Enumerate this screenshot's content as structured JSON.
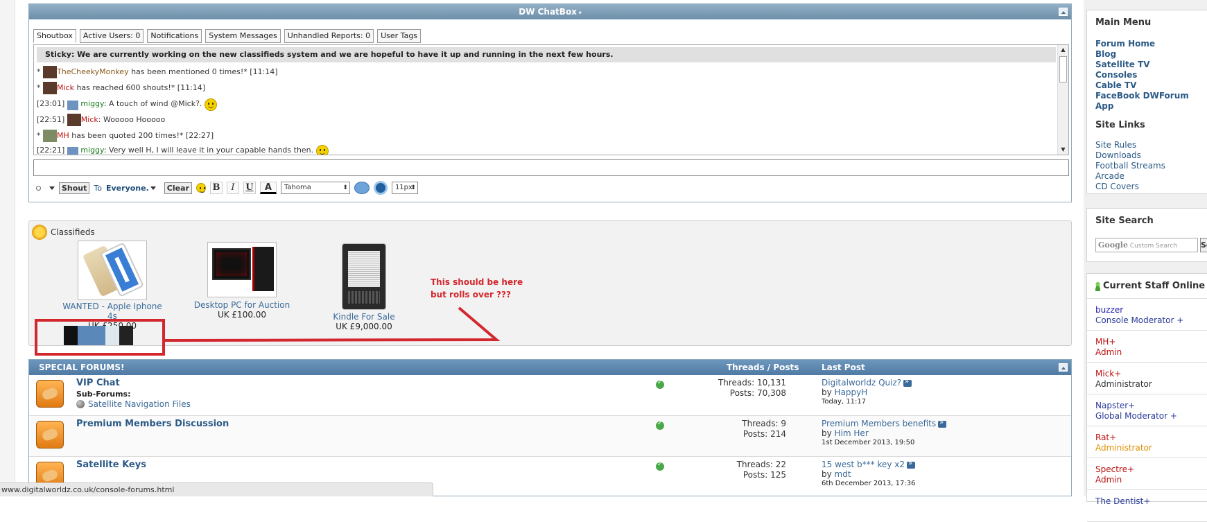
{
  "chatbox": {
    "title": "DW ChatBox",
    "tabs": [
      "Shoutbox",
      "Active Users: 0",
      "Notifications",
      "System Messages",
      "Unhandled Reports: 0",
      "User Tags"
    ],
    "sticky": "Sticky: We are currently working on the new classifieds system and we are hopeful to have it up and running in the next few hours.",
    "messages": [
      {
        "pre": "*",
        "user": "TheCheekyMonkey",
        "text": " has been mentioned 0 times!* [11:14]"
      },
      {
        "pre": "*",
        "user": "Mick",
        "text": " has reached 600 shouts!* [11:14]"
      },
      {
        "pre": "[23:01]",
        "user": "miggy",
        "text": ": A touch of wind @Mick?."
      },
      {
        "pre": "[22:51]",
        "user": "Mick",
        "text": ": Wooooo Hooooo"
      },
      {
        "pre": "*",
        "user": "MH",
        "text": " has been quoted 200 times!* [22:27]"
      },
      {
        "pre": "[22:21]",
        "user": "miggy",
        "text": ": Very well H, I will leave it in your capable hands then."
      }
    ],
    "toolbar": {
      "shout": "Shout",
      "to": "To",
      "everyone": "Everyone.",
      "clear": "Clear",
      "bold": "B",
      "italic": "I",
      "underline": "U",
      "fontcolor": "A",
      "font": "Tahoma",
      "size": "11px"
    }
  },
  "classifieds": {
    "title": "Classifieds",
    "items": [
      {
        "name": "WANTED - Apple Iphone 4s",
        "price": "UK £250.00"
      },
      {
        "name": "Desktop PC for Auction",
        "price": "UK £100.00"
      },
      {
        "name": "Kindle For Sale",
        "price": "UK £9,000.00"
      }
    ],
    "note_line1": "This should be here",
    "note_line2": "but rolls over ???"
  },
  "forums": {
    "title": "SPECIAL FORUMS!",
    "col_threads": "Threads / Posts",
    "col_last": "Last Post",
    "rows": [
      {
        "title": "VIP Chat",
        "sub_label": "Sub-Forums:",
        "sub_link": "Satellite Navigation Files",
        "threads": "Threads: 10,131",
        "posts": "Posts: 70,308",
        "last_title": "Digitalworldz Quiz?",
        "by": "by",
        "last_user": "HappyH",
        "last_date": "Today, 11:17"
      },
      {
        "title": "Premium Members Discussion",
        "threads": "Threads: 9",
        "posts": "Posts: 214",
        "last_title": "Premium Members benefits",
        "by": "by",
        "last_user": "Him Her",
        "last_date": "1st December 2013, 19:50"
      },
      {
        "title": "Satellite Keys",
        "threads": "Threads: 22",
        "posts": "Posts: 125",
        "last_title": "15 west b*** key x2",
        "by": "by",
        "last_user": "mdt",
        "last_date": "6th December 2013, 17:36"
      }
    ]
  },
  "statusbar": {
    "url": "www.digitalworldz.co.uk/console-forums.html"
  },
  "sidebar": {
    "main_menu": {
      "title": "Main Menu",
      "links": [
        "Forum Home",
        "Blog",
        "Satellite TV",
        "Consoles",
        "Cable TV",
        "FaceBook DWForum App"
      ]
    },
    "site_links": {
      "title": "Site Links",
      "links": [
        "Site Rules",
        "Downloads",
        "Football Streams",
        "Arcade",
        "CD Covers"
      ]
    },
    "site_search": {
      "title": "Site Search",
      "google": "Google",
      "placeholder": "Custom Search",
      "button": "Se"
    },
    "staff": {
      "title": "Current Staff Online",
      "members": [
        {
          "name": "buzzer",
          "role": "Console Moderator +"
        },
        {
          "name": "MH+",
          "role": "Admin"
        },
        {
          "name": "Mick+",
          "role": "Administrator"
        },
        {
          "name": "Napster+",
          "role": "Global Moderator +"
        },
        {
          "name": "Rat+",
          "role": "Administrator"
        },
        {
          "name": "Spectre+",
          "role": "Admin"
        },
        {
          "name": "The Dentist+",
          "role": ""
        }
      ]
    }
  }
}
